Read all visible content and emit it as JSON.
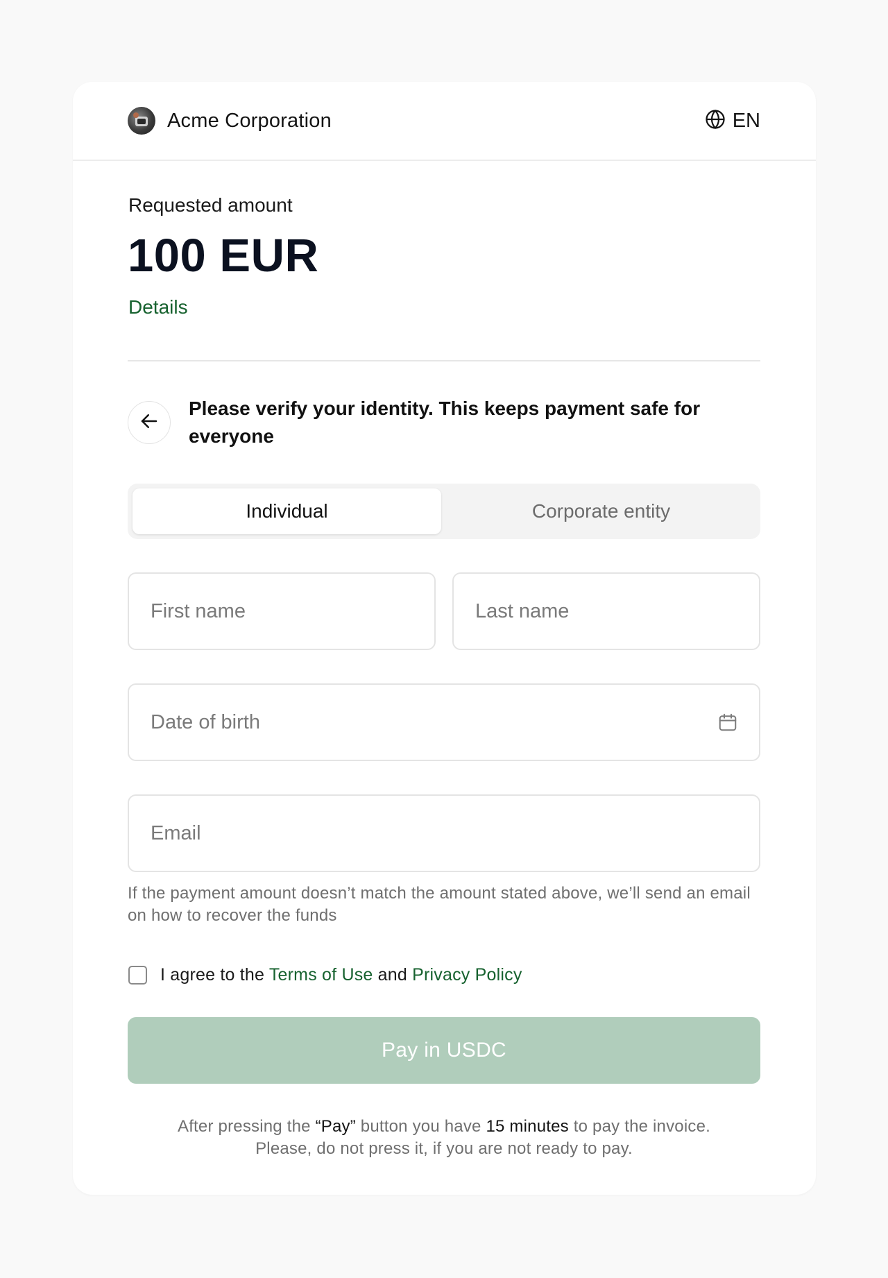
{
  "header": {
    "company_name": "Acme Corporation",
    "language": "EN"
  },
  "amount_section": {
    "label": "Requested amount",
    "value": "100 EUR",
    "details_link": "Details"
  },
  "verify": {
    "message": "Please verify your identity. This keeps payment safe for everyone"
  },
  "entity_tabs": {
    "items": [
      {
        "label": "Individual",
        "selected": true
      },
      {
        "label": "Corporate entity",
        "selected": false
      }
    ]
  },
  "form": {
    "first_name": {
      "placeholder": "First name",
      "value": ""
    },
    "last_name": {
      "placeholder": "Last name",
      "value": ""
    },
    "date_of_birth": {
      "placeholder": "Date of birth",
      "value": ""
    },
    "email": {
      "placeholder": "Email",
      "value": ""
    },
    "helper_text": "If the payment amount doesn’t match the amount stated above, we’ll send an email on how to recover the funds"
  },
  "agreement": {
    "checked": false,
    "prefix": "I agree to the",
    "terms_link": "Terms of Use",
    "conjunction": "and",
    "privacy_link": "Privacy Policy"
  },
  "pay_button": {
    "label": "Pay in USDC",
    "enabled": false
  },
  "footnote": {
    "part1": "After pressing the",
    "pay_quote": "“Pay”",
    "part2": "button you have",
    "minutes": "15 minutes",
    "part3": "to pay the invoice.",
    "line2": "Please, do not press it, if you are not ready to pay."
  },
  "colors": {
    "page_background": "#f9f9f9",
    "card_background": "#ffffff",
    "link_green": "#17622f",
    "pay_button_disabled": "#b0cdbb",
    "tab_track": "#f3f3f3"
  },
  "icons": {
    "brand": "company-logo",
    "language": "globe-icon",
    "back": "arrow-left-icon",
    "date": "calendar-icon"
  }
}
